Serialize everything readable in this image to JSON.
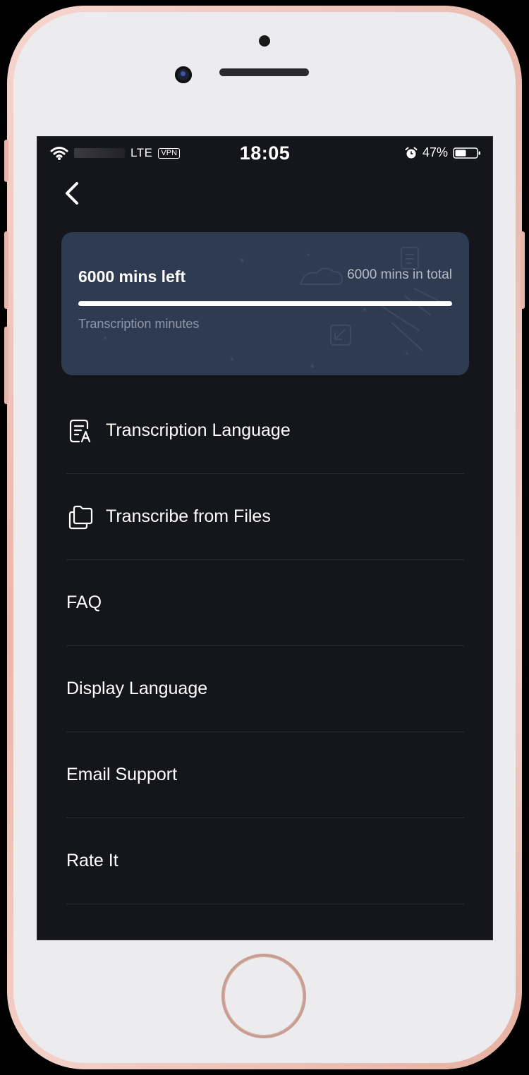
{
  "status_bar": {
    "network": "LTE",
    "vpn": "VPN",
    "time": "18:05",
    "battery": "47%"
  },
  "usage": {
    "minutes_left": "6000 mins left",
    "minutes_total": "6000 mins in total",
    "caption": "Transcription minutes",
    "progress_fraction": 1.0
  },
  "menu": {
    "items": [
      {
        "label": "Transcription Language",
        "icon": "transcription-language-icon"
      },
      {
        "label": "Transcribe from Files",
        "icon": "folder-icon"
      },
      {
        "label": "FAQ"
      },
      {
        "label": "Display Language"
      },
      {
        "label": "Email Support"
      },
      {
        "label": "Rate It"
      }
    ]
  },
  "colors": {
    "screen_bg": "#15161b",
    "card_bg": "#2e3b51",
    "divider": "#2b2c33",
    "text": "#ffffff",
    "muted_text": "#8e98aa",
    "phone_frame": "#f3d1c8"
  }
}
